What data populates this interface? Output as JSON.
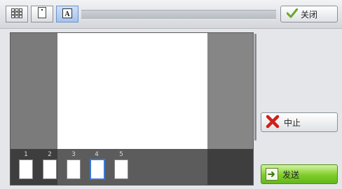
{
  "toolbar": {
    "view_buttons": [
      {
        "icon": "grid-view-icon",
        "active": false
      },
      {
        "icon": "single-page-view-icon",
        "active": false
      },
      {
        "icon": "text-page-view-icon",
        "active": true
      }
    ],
    "close_label": "关闭",
    "close_icon": "checkmark-icon"
  },
  "preview": {
    "pages": [
      "1",
      "2",
      "3",
      "4",
      "5"
    ],
    "selected_page": "4"
  },
  "actions": {
    "stop_label": "中止",
    "stop_icon": "red-x-icon",
    "send_label": "发送",
    "send_icon": "send-document-icon"
  },
  "colors": {
    "accent_selected": "#3a78d8",
    "send_green": "#7fcc2a",
    "stop_red": "#d0201a"
  }
}
